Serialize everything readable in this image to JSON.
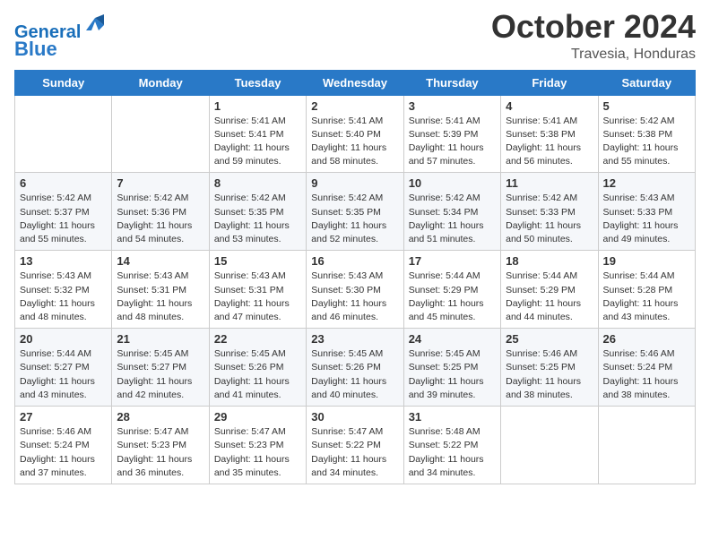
{
  "header": {
    "logo_line1": "General",
    "logo_line2": "Blue",
    "month": "October 2024",
    "location": "Travesia, Honduras"
  },
  "days_of_week": [
    "Sunday",
    "Monday",
    "Tuesday",
    "Wednesday",
    "Thursday",
    "Friday",
    "Saturday"
  ],
  "weeks": [
    [
      {
        "day": "",
        "info": ""
      },
      {
        "day": "",
        "info": ""
      },
      {
        "day": "1",
        "info": "Sunrise: 5:41 AM\nSunset: 5:41 PM\nDaylight: 11 hours and 59 minutes."
      },
      {
        "day": "2",
        "info": "Sunrise: 5:41 AM\nSunset: 5:40 PM\nDaylight: 11 hours and 58 minutes."
      },
      {
        "day": "3",
        "info": "Sunrise: 5:41 AM\nSunset: 5:39 PM\nDaylight: 11 hours and 57 minutes."
      },
      {
        "day": "4",
        "info": "Sunrise: 5:41 AM\nSunset: 5:38 PM\nDaylight: 11 hours and 56 minutes."
      },
      {
        "day": "5",
        "info": "Sunrise: 5:42 AM\nSunset: 5:38 PM\nDaylight: 11 hours and 55 minutes."
      }
    ],
    [
      {
        "day": "6",
        "info": "Sunrise: 5:42 AM\nSunset: 5:37 PM\nDaylight: 11 hours and 55 minutes."
      },
      {
        "day": "7",
        "info": "Sunrise: 5:42 AM\nSunset: 5:36 PM\nDaylight: 11 hours and 54 minutes."
      },
      {
        "day": "8",
        "info": "Sunrise: 5:42 AM\nSunset: 5:35 PM\nDaylight: 11 hours and 53 minutes."
      },
      {
        "day": "9",
        "info": "Sunrise: 5:42 AM\nSunset: 5:35 PM\nDaylight: 11 hours and 52 minutes."
      },
      {
        "day": "10",
        "info": "Sunrise: 5:42 AM\nSunset: 5:34 PM\nDaylight: 11 hours and 51 minutes."
      },
      {
        "day": "11",
        "info": "Sunrise: 5:42 AM\nSunset: 5:33 PM\nDaylight: 11 hours and 50 minutes."
      },
      {
        "day": "12",
        "info": "Sunrise: 5:43 AM\nSunset: 5:33 PM\nDaylight: 11 hours and 49 minutes."
      }
    ],
    [
      {
        "day": "13",
        "info": "Sunrise: 5:43 AM\nSunset: 5:32 PM\nDaylight: 11 hours and 48 minutes."
      },
      {
        "day": "14",
        "info": "Sunrise: 5:43 AM\nSunset: 5:31 PM\nDaylight: 11 hours and 48 minutes."
      },
      {
        "day": "15",
        "info": "Sunrise: 5:43 AM\nSunset: 5:31 PM\nDaylight: 11 hours and 47 minutes."
      },
      {
        "day": "16",
        "info": "Sunrise: 5:43 AM\nSunset: 5:30 PM\nDaylight: 11 hours and 46 minutes."
      },
      {
        "day": "17",
        "info": "Sunrise: 5:44 AM\nSunset: 5:29 PM\nDaylight: 11 hours and 45 minutes."
      },
      {
        "day": "18",
        "info": "Sunrise: 5:44 AM\nSunset: 5:29 PM\nDaylight: 11 hours and 44 minutes."
      },
      {
        "day": "19",
        "info": "Sunrise: 5:44 AM\nSunset: 5:28 PM\nDaylight: 11 hours and 43 minutes."
      }
    ],
    [
      {
        "day": "20",
        "info": "Sunrise: 5:44 AM\nSunset: 5:27 PM\nDaylight: 11 hours and 43 minutes."
      },
      {
        "day": "21",
        "info": "Sunrise: 5:45 AM\nSunset: 5:27 PM\nDaylight: 11 hours and 42 minutes."
      },
      {
        "day": "22",
        "info": "Sunrise: 5:45 AM\nSunset: 5:26 PM\nDaylight: 11 hours and 41 minutes."
      },
      {
        "day": "23",
        "info": "Sunrise: 5:45 AM\nSunset: 5:26 PM\nDaylight: 11 hours and 40 minutes."
      },
      {
        "day": "24",
        "info": "Sunrise: 5:45 AM\nSunset: 5:25 PM\nDaylight: 11 hours and 39 minutes."
      },
      {
        "day": "25",
        "info": "Sunrise: 5:46 AM\nSunset: 5:25 PM\nDaylight: 11 hours and 38 minutes."
      },
      {
        "day": "26",
        "info": "Sunrise: 5:46 AM\nSunset: 5:24 PM\nDaylight: 11 hours and 38 minutes."
      }
    ],
    [
      {
        "day": "27",
        "info": "Sunrise: 5:46 AM\nSunset: 5:24 PM\nDaylight: 11 hours and 37 minutes."
      },
      {
        "day": "28",
        "info": "Sunrise: 5:47 AM\nSunset: 5:23 PM\nDaylight: 11 hours and 36 minutes."
      },
      {
        "day": "29",
        "info": "Sunrise: 5:47 AM\nSunset: 5:23 PM\nDaylight: 11 hours and 35 minutes."
      },
      {
        "day": "30",
        "info": "Sunrise: 5:47 AM\nSunset: 5:22 PM\nDaylight: 11 hours and 34 minutes."
      },
      {
        "day": "31",
        "info": "Sunrise: 5:48 AM\nSunset: 5:22 PM\nDaylight: 11 hours and 34 minutes."
      },
      {
        "day": "",
        "info": ""
      },
      {
        "day": "",
        "info": ""
      }
    ]
  ]
}
